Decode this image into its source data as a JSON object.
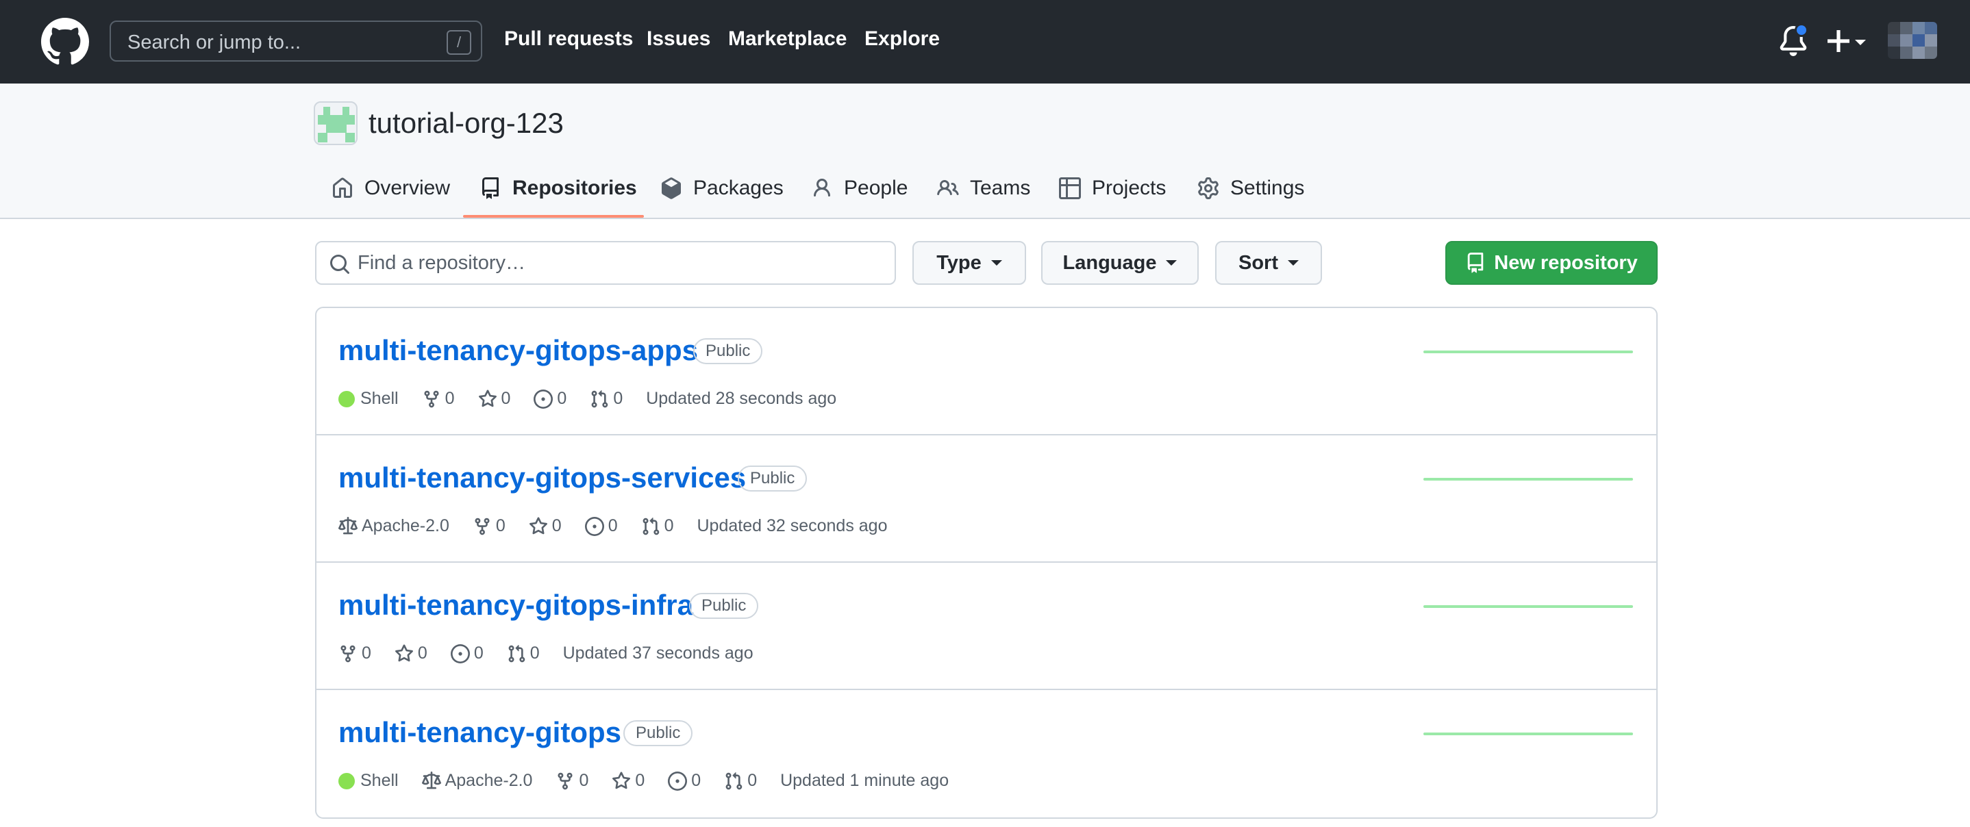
{
  "header": {
    "search_placeholder": "Search or jump to...",
    "search_shortcut": "/",
    "nav": [
      "Pull requests",
      "Issues",
      "Marketplace",
      "Explore"
    ]
  },
  "org": {
    "name": "tutorial-org-123",
    "tabs": [
      {
        "label": "Overview",
        "icon": "home-icon"
      },
      {
        "label": "Repositories",
        "icon": "repo-icon",
        "active": true
      },
      {
        "label": "Packages",
        "icon": "package-icon"
      },
      {
        "label": "People",
        "icon": "person-icon"
      },
      {
        "label": "Teams",
        "icon": "people-icon"
      },
      {
        "label": "Projects",
        "icon": "table-icon"
      },
      {
        "label": "Settings",
        "icon": "gear-icon"
      }
    ]
  },
  "filters": {
    "find_placeholder": "Find a repository…",
    "type_label": "Type",
    "language_label": "Language",
    "sort_label": "Sort",
    "new_repo_label": "New repository"
  },
  "repos": [
    {
      "name": "multi-tenancy-gitops-apps",
      "visibility": "Public",
      "language": "Shell",
      "license": "",
      "forks": "0",
      "stars": "0",
      "issues": "0",
      "prs": "0",
      "updated": "Updated 28 seconds ago"
    },
    {
      "name": "multi-tenancy-gitops-services",
      "visibility": "Public",
      "language": "",
      "license": "Apache-2.0",
      "forks": "0",
      "stars": "0",
      "issues": "0",
      "prs": "0",
      "updated": "Updated 32 seconds ago"
    },
    {
      "name": "multi-tenancy-gitops-infra",
      "visibility": "Public",
      "language": "",
      "license": "",
      "forks": "0",
      "stars": "0",
      "issues": "0",
      "prs": "0",
      "updated": "Updated 37 seconds ago"
    },
    {
      "name": "multi-tenancy-gitops",
      "visibility": "Public",
      "language": "Shell",
      "license": "Apache-2.0",
      "forks": "0",
      "stars": "0",
      "issues": "0",
      "prs": "0",
      "updated": "Updated 1 minute ago"
    }
  ],
  "colors": {
    "header_bg": "#24292f",
    "link": "#0969da",
    "primary_button": "#2da44e",
    "shell_language": "#89e051",
    "tab_underline": "#fd8c73",
    "notification_dot": "#2f81f7"
  }
}
